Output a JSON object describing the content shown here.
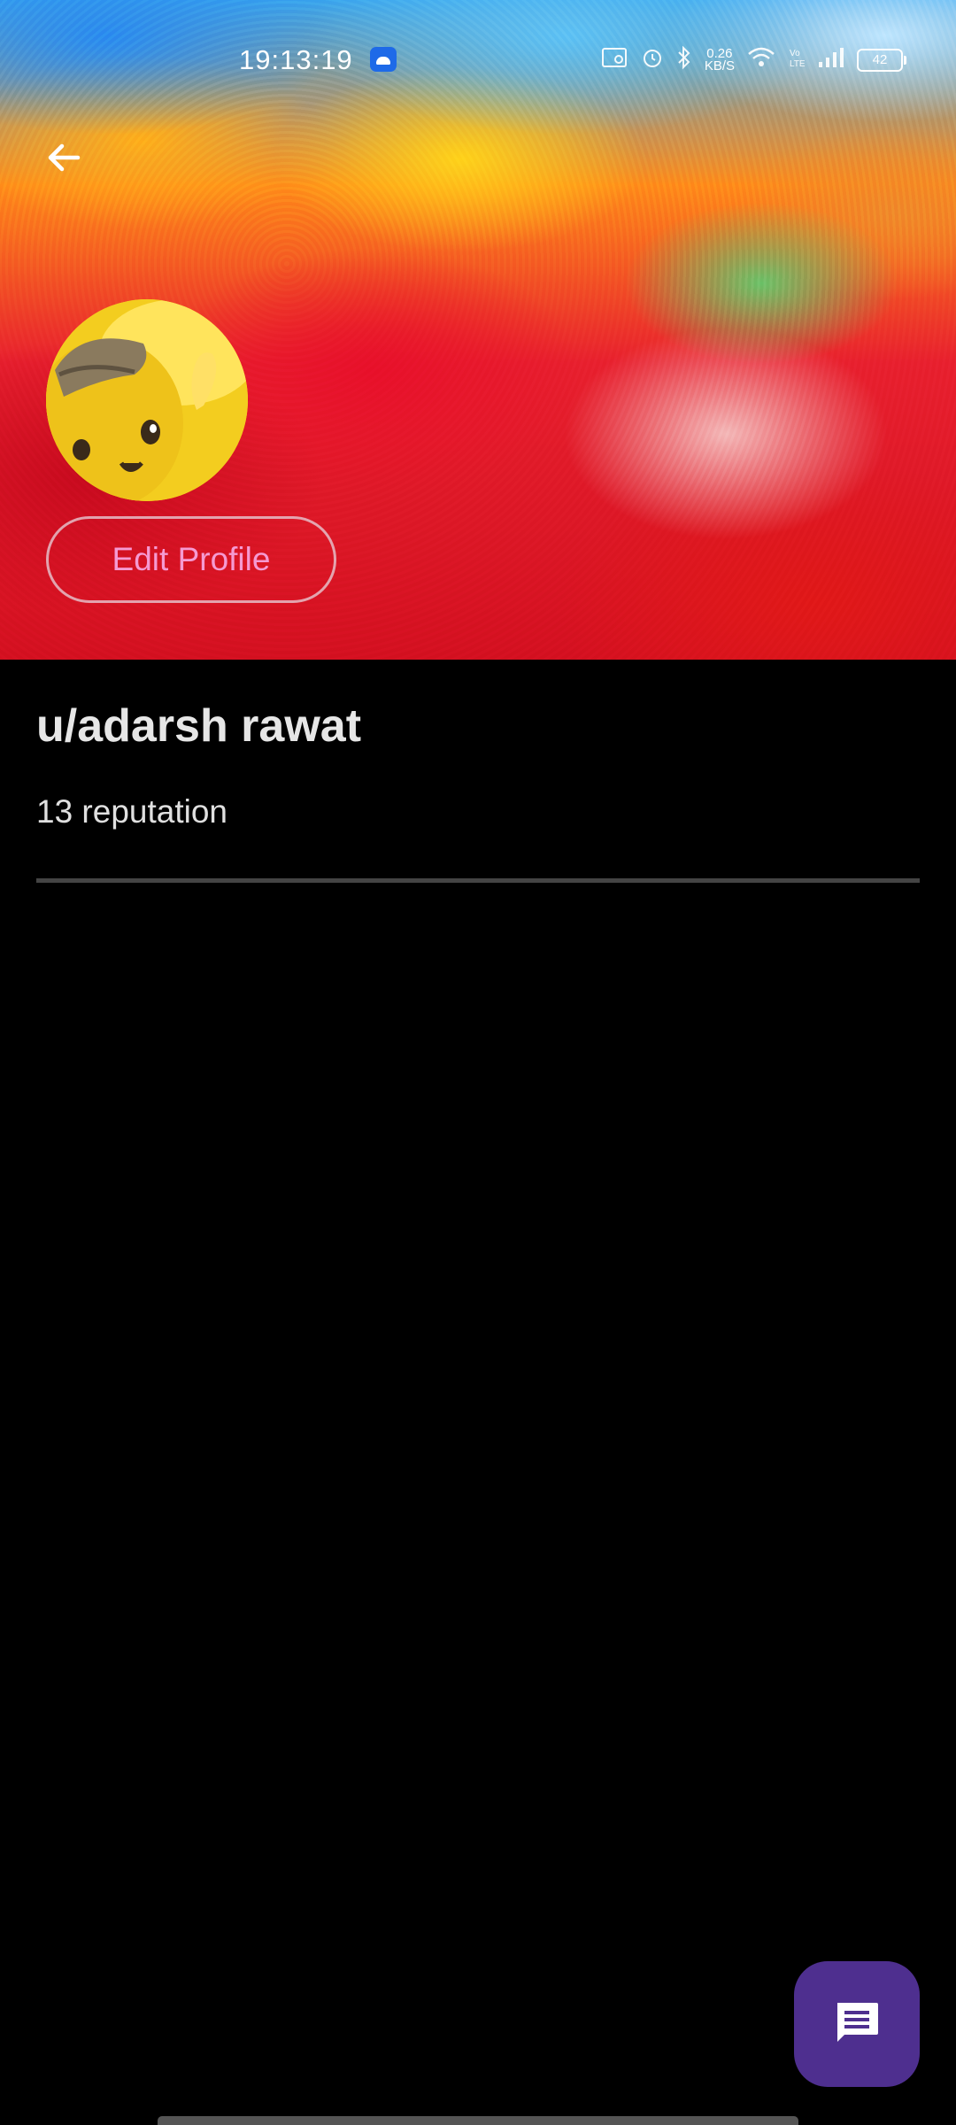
{
  "status_bar": {
    "time": "19:13:19",
    "net_speed_value": "0.26",
    "net_speed_unit": "KB/S",
    "battery": "42"
  },
  "header": {
    "back_icon": "arrow-left-icon"
  },
  "profile": {
    "avatar_icon": "avatar-image",
    "edit_button_label": "Edit Profile",
    "username": "u/adarsh rawat",
    "reputation": "13 reputation"
  },
  "fab": {
    "icon": "message-icon"
  },
  "colors": {
    "background": "#000000",
    "edit_button_text": "#f59ad2",
    "fab_background": "#4e2f8f",
    "divider": "#444444"
  }
}
